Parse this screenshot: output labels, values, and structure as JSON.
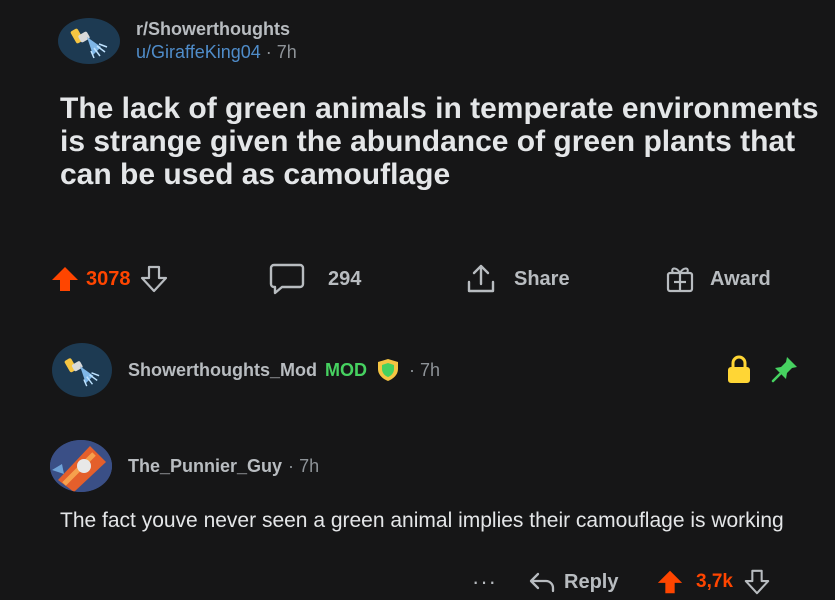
{
  "post": {
    "subreddit": "r/Showerthoughts",
    "author": "u/GiraffeKing04",
    "separator": " · ",
    "age": "7h",
    "title": "The lack of green animals in temperate environments is strange given the abundance of green plants that can be used as camouflage",
    "score": "3078",
    "comments": "294",
    "share_label": "Share",
    "award_label": "Award"
  },
  "mod_comment": {
    "username": "Showerthoughts_Mod",
    "badge": "MOD",
    "separator": "·",
    "age": "7h"
  },
  "comment": {
    "username": "The_Punnier_Guy",
    "separator": "·",
    "age": "7h",
    "body": "The fact youve never seen a green animal implies their camouflage is working",
    "more_label": "···",
    "reply_label": "Reply",
    "score": "3,7k"
  },
  "icons": {
    "subreddit_avatar": "shower-head-icon",
    "upvote": "upvote-arrow-icon",
    "downvote": "downvote-arrow-icon",
    "comment": "comment-bubble-icon",
    "share": "share-icon",
    "award": "award-gift-icon",
    "lock": "lock-icon",
    "pin": "pin-icon",
    "shield": "mod-shield-icon",
    "reply": "reply-arrow-icon"
  },
  "colors": {
    "background": "#161617",
    "upvote": "#ff4500",
    "mod_green": "#46d160",
    "lock_yellow": "#ffd635",
    "user_link": "#4f8cc9"
  }
}
